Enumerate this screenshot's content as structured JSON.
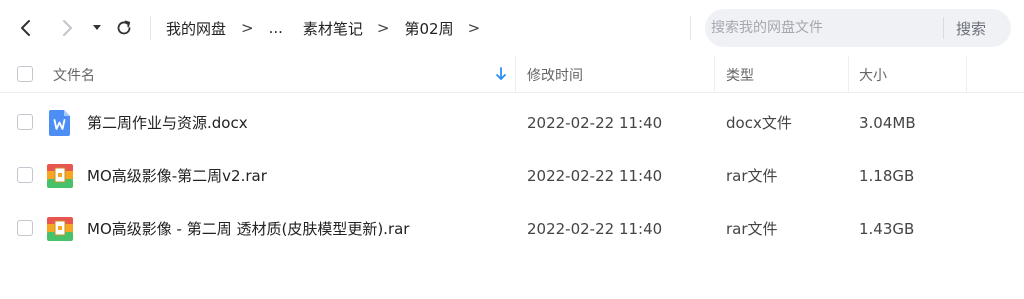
{
  "toolbar": {
    "breadcrumb": [
      "我的网盘",
      "...",
      "素材笔记",
      "第02周"
    ],
    "separator": ">"
  },
  "search": {
    "placeholder": "搜索我的网盘文件",
    "button_label": "搜索"
  },
  "columns": {
    "name": "文件名",
    "modified": "修改时间",
    "type": "类型",
    "size": "大小"
  },
  "files": [
    {
      "name": "第二周作业与资源.docx",
      "modified": "2022-02-22 11:40",
      "type": "docx文件",
      "size": "3.04MB",
      "icon": "word-doc-icon"
    },
    {
      "name": "MO高级影像-第二周v2.rar",
      "modified": "2022-02-22 11:40",
      "type": "rar文件",
      "size": "1.18GB",
      "icon": "rar-archive-icon"
    },
    {
      "name": "MO高级影像 - 第二周 透材质(皮肤模型更新).rar",
      "modified": "2022-02-22 11:40",
      "type": "rar文件",
      "size": "1.43GB",
      "icon": "rar-archive-icon"
    }
  ],
  "colors": {
    "accent": "#2c8cf4",
    "word_icon": "#4c8ef4",
    "archive_orange": "#f6a623",
    "archive_green": "#47c26a",
    "archive_red": "#e8554e"
  }
}
